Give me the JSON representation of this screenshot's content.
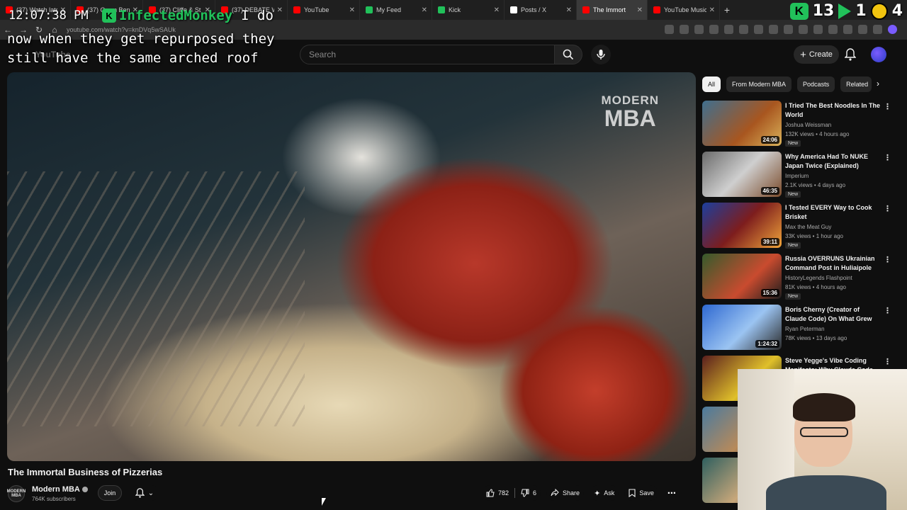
{
  "browser": {
    "tabs": [
      {
        "label": "(37) Watch late",
        "color": "#ff0000"
      },
      {
        "label": "(37) Owen Ben",
        "color": "#ff0000"
      },
      {
        "label": "(37) Cliffe & St",
        "color": "#ff0000"
      },
      {
        "label": "(37) DEBATE W",
        "color": "#ff0000"
      },
      {
        "label": "YouTube",
        "color": "#ff0000"
      },
      {
        "label": "My Feed",
        "color": "#21c15a"
      },
      {
        "label": "Kick",
        "color": "#21c15a"
      },
      {
        "label": "Posts / X",
        "color": "#ffffff"
      },
      {
        "label": "The Immort",
        "color": "#ff0000",
        "active": true
      },
      {
        "label": "YouTube Music",
        "color": "#ff0000"
      }
    ],
    "url": "youtube.com/watch?v=knDVq5wSAUk"
  },
  "overlay": {
    "clock": "12:07:38 PM",
    "chat_badge": "K",
    "chat_user": "InfectedMonkey",
    "chat_message": "I do",
    "caption": "now when they get repurposed they\nstill have the same arched roof",
    "widget_k": "K",
    "widget_num1": "13",
    "widget_num2": "1",
    "widget_num3": "4"
  },
  "header": {
    "logo": "YouTube",
    "search_placeholder": "Search",
    "create_label": "Create"
  },
  "video": {
    "watermark_top": "MODERN",
    "watermark_bottom": "MBA",
    "title": "The Immortal Business of Pizzerias",
    "channel": {
      "avatar_text": "MODERN MBA",
      "name": "Modern MBA",
      "subscribers": "764K subscribers",
      "join_label": "Join"
    },
    "actions": {
      "likes": "782",
      "dislikes": "6",
      "share": "Share",
      "ask": "Ask",
      "save": "Save"
    }
  },
  "sidebar": {
    "chips": [
      "All",
      "From Modern MBA",
      "Podcasts",
      "Related"
    ],
    "items": [
      {
        "title": "I Tried The Best Noodles In The World",
        "channel": "Joshua Weissman",
        "meta": "132K views • 4 hours ago",
        "duration": "24:06",
        "new": "New"
      },
      {
        "title": "Why America Had To NUKE Japan Twice (Explained)",
        "channel": "Imperium",
        "meta": "2.1K views • 4 days ago",
        "duration": "46:35",
        "new": "New"
      },
      {
        "title": "I Tested EVERY Way to Cook Brisket",
        "channel": "Max the Meat Guy",
        "meta": "33K views • 1 hour ago",
        "duration": "39:11",
        "new": "New"
      },
      {
        "title": "Russia OVERRUNS Ukrainian Command Post in Huliaipole",
        "channel": "HistoryLegends Flashpoint",
        "meta": "81K views • 4 hours ago",
        "duration": "15:36",
        "new": "New"
      },
      {
        "title": "Boris Cherny (Creator of Claude Code) On What Grew His Care...",
        "channel": "Ryan Peterman",
        "meta": "78K views • 13 days ago",
        "duration": "1:24:32",
        "new": ""
      },
      {
        "title": "Steve Yegge's Vibe Coding Manifesto: Why Claude Code...",
        "channel": "",
        "meta": "",
        "duration": "",
        "new": ""
      }
    ]
  }
}
